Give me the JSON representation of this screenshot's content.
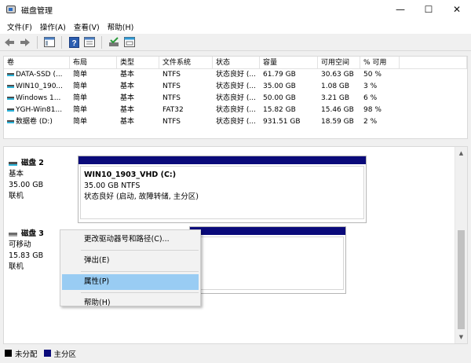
{
  "window": {
    "title": "磁盘管理",
    "minimize": "—",
    "maximize": "☐",
    "close": "✕"
  },
  "menu": [
    "文件(F)",
    "操作(A)",
    "查看(V)",
    "帮助(H)"
  ],
  "toolbar_icons": [
    "back-arrow-icon",
    "forward-arrow-icon",
    "console-tree-icon",
    "help-icon",
    "properties-icon",
    "disk-check-icon",
    "window-icon"
  ],
  "volume_table": {
    "headers": [
      "卷",
      "布局",
      "类型",
      "文件系统",
      "状态",
      "容量",
      "可用空间",
      "% 可用",
      ""
    ],
    "rows": [
      [
        "DATA-SSD (...",
        "简单",
        "基本",
        "NTFS",
        "状态良好 (...",
        "61.79 GB",
        "30.63 GB",
        "50 %"
      ],
      [
        "WIN10_190...",
        "简单",
        "基本",
        "NTFS",
        "状态良好 (...",
        "35.00 GB",
        "1.08 GB",
        "3 %"
      ],
      [
        "Windows 1...",
        "简单",
        "基本",
        "NTFS",
        "状态良好 (...",
        "50.00 GB",
        "3.21 GB",
        "6 %"
      ],
      [
        "YGH-Win81...",
        "简单",
        "基本",
        "FAT32",
        "状态良好 (...",
        "15.82 GB",
        "15.46 GB",
        "98 %"
      ],
      [
        "数据卷 (D:)",
        "简单",
        "基本",
        "NTFS",
        "状态良好 (...",
        "931.51 GB",
        "18.59 GB",
        "2 %"
      ]
    ]
  },
  "disk2": {
    "name": "磁盘 2",
    "type": "基本",
    "size": "35.00 GB",
    "status": "联机",
    "partition": {
      "title": "WIN10_1903_VHD  (C:)",
      "size_fs": "35.00 GB NTFS",
      "status": "状态良好 (启动, 故障转储, 主分区)"
    }
  },
  "disk3": {
    "name": "磁盘 3",
    "type": "可移动",
    "size": "15.83 GB",
    "status": "联机"
  },
  "context_menu": {
    "change_letter": "更改驱动器号和路径(C)...",
    "eject": "弹出(E)",
    "properties": "属性(P)",
    "help": "帮助(H)"
  },
  "legend": {
    "unallocated": "未分配",
    "primary": "主分区",
    "unallocated_color": "#000000",
    "primary_color": "#0a0a7a"
  },
  "colors": {
    "highlight": "#99ccf3",
    "partition_bar": "#0a0a7a"
  }
}
